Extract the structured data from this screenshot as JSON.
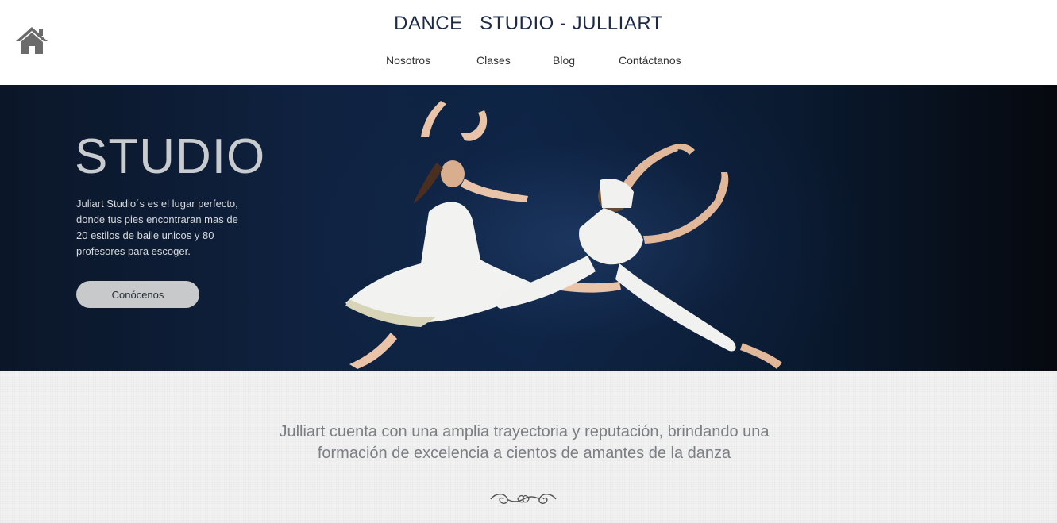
{
  "header": {
    "title": "DANCE   STUDIO - JULLIART",
    "home_icon": "home-icon",
    "nav": [
      "Nosotros",
      "Clases",
      "Blog",
      "Contáctanos"
    ]
  },
  "hero": {
    "heading": "STUDIO",
    "text": "Juliart Studio´s es el lugar perfecto, donde tus pies encontraran mas de 20 estilos de baile unicos y 80 profesores para escoger.",
    "button_label": "Conócenos"
  },
  "info": {
    "text": "Julliart cuenta con una amplia trayectoria y reputación, brindando una formación de excelencia a cientos de amantes de la danza",
    "ornament_icon": "flourish-ornament-icon"
  },
  "colors": {
    "title": "#1c2a45",
    "hero_bg": "#0f2240",
    "button_bg": "#c8c9ca",
    "info_text": "#7b7e82",
    "info_bg": "#f2f2f2"
  }
}
